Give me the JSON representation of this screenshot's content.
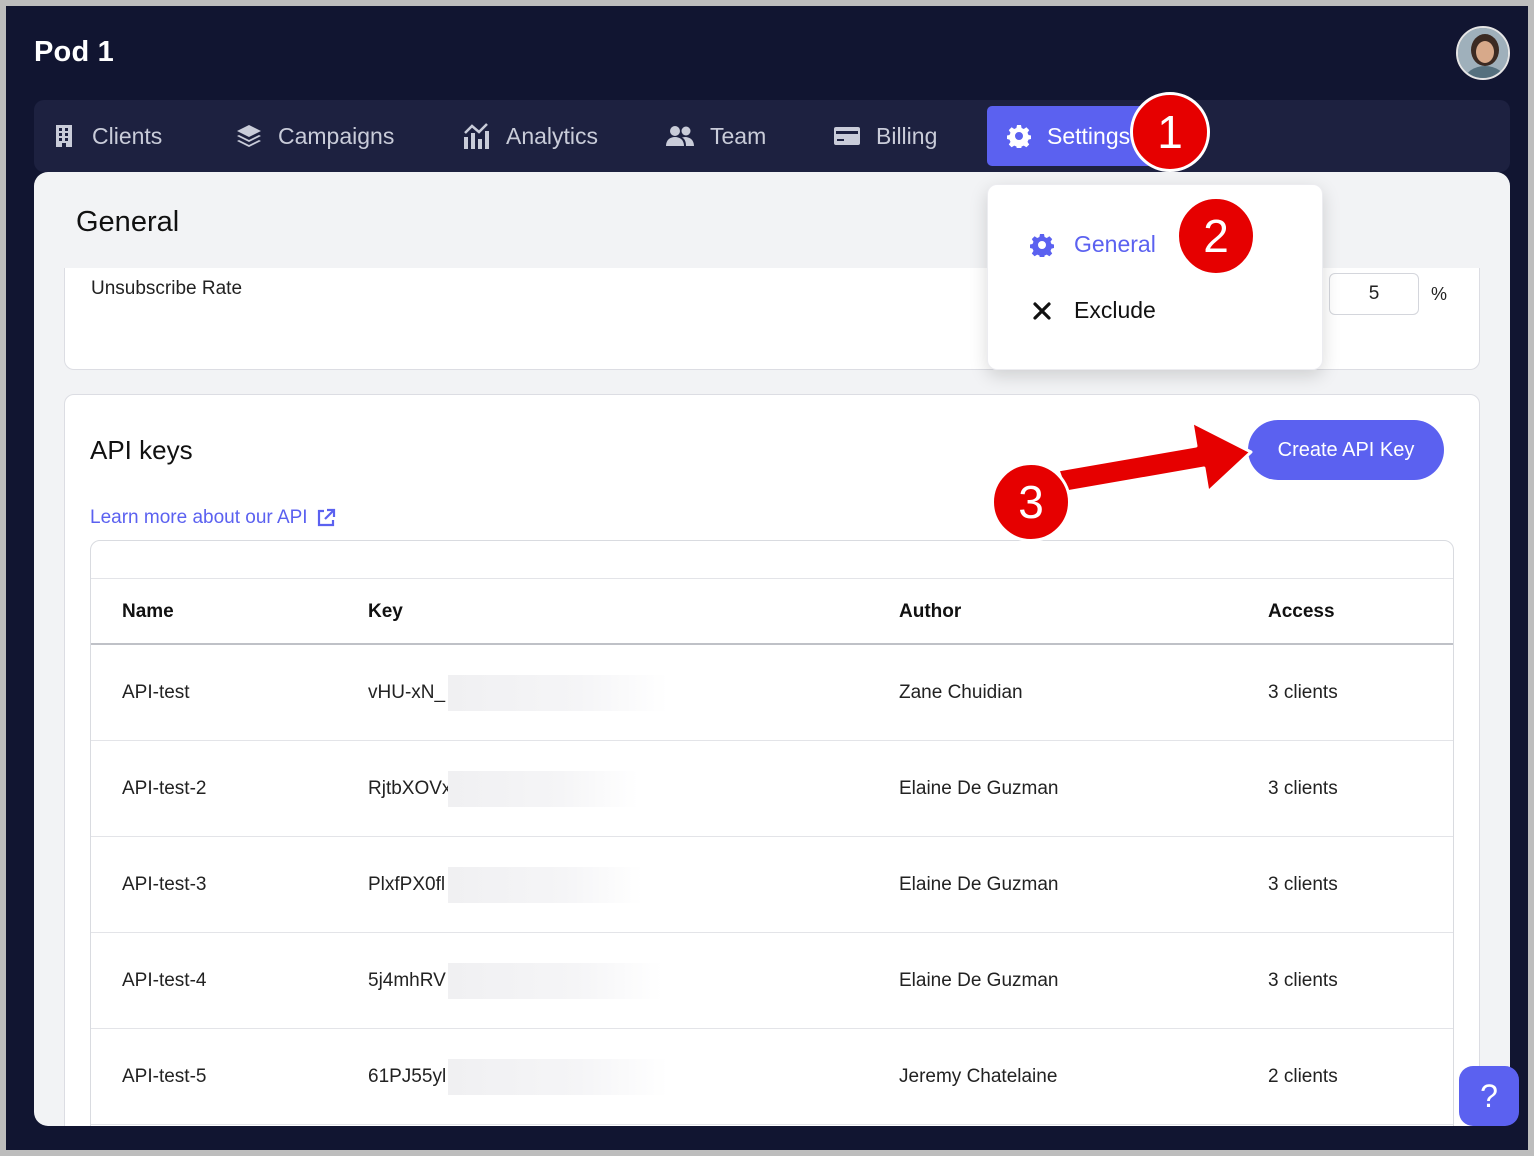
{
  "app": {
    "title": "Pod 1"
  },
  "nav": {
    "clients": "Clients",
    "campaigns": "Campaigns",
    "analytics": "Analytics",
    "team": "Team",
    "billing": "Billing",
    "settings": "Settings"
  },
  "general": {
    "title": "General",
    "unsubscribe_label": "Unsubscribe Rate",
    "unsubscribe_value": "5",
    "unsubscribe_unit": "%"
  },
  "settings_menu": {
    "items": [
      {
        "label": "General",
        "icon": "gear-icon",
        "active": true
      },
      {
        "label": "Exclude",
        "icon": "close-icon",
        "active": false
      }
    ]
  },
  "api_keys": {
    "title": "API keys",
    "learn_more": "Learn more about our API",
    "create_button": "Create API Key",
    "columns": [
      "Name",
      "Key",
      "Author",
      "Access"
    ],
    "rows": [
      {
        "name": "API-test",
        "key": "vHU-xN_",
        "author": "Zane Chuidian",
        "access": "3 clients"
      },
      {
        "name": "API-test-2",
        "key": "RjtbXOVx",
        "author": "Elaine De Guzman",
        "access": "3 clients"
      },
      {
        "name": "API-test-3",
        "key": "PlxfPX0fl",
        "author": "Elaine De Guzman",
        "access": "3 clients"
      },
      {
        "name": "API-test-4",
        "key": "5j4mhRV",
        "author": "Elaine De Guzman",
        "access": "3 clients"
      },
      {
        "name": "API-test-5",
        "key": "61PJ55yl",
        "author": "Jeremy Chatelaine",
        "access": "2 clients"
      }
    ]
  },
  "annotations": {
    "step1": "1",
    "step2": "2",
    "step3": "3"
  },
  "help": {
    "label": "?"
  },
  "colors": {
    "accent": "#5b61f0",
    "nav_bg": "#111531",
    "annotation": "#e60000"
  }
}
